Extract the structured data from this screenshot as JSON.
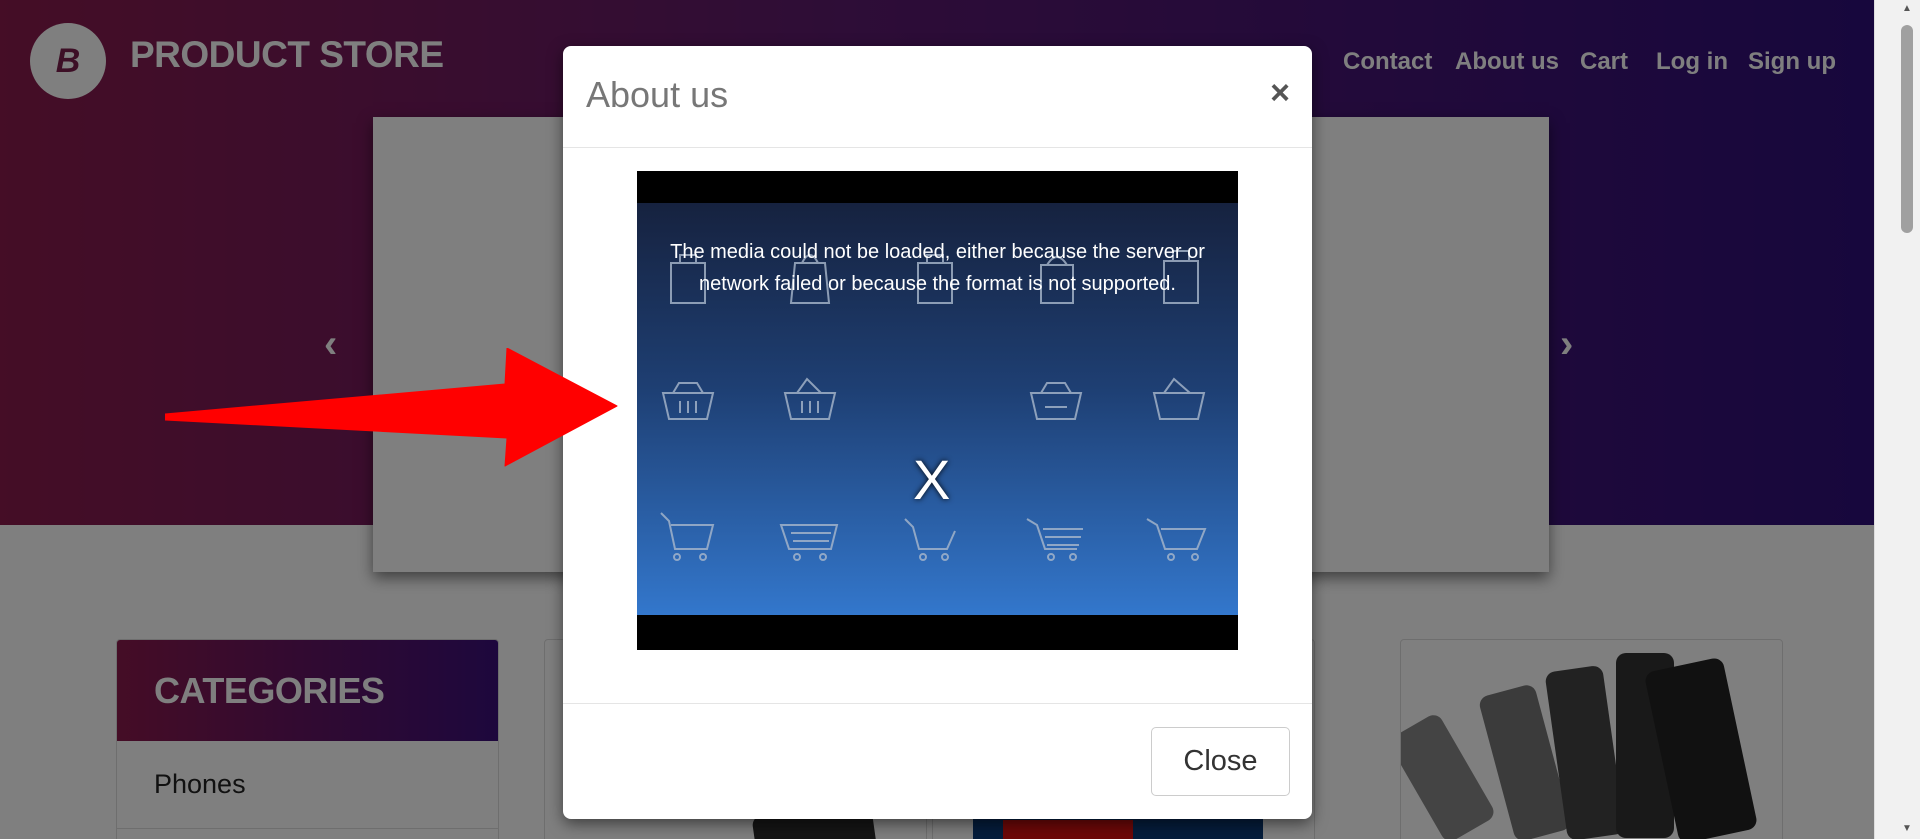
{
  "header": {
    "brand": "PRODUCT STORE",
    "logo_letter": "B",
    "nav": [
      "Contact",
      "About us",
      "Cart",
      "Log in",
      "Sign up"
    ],
    "nav_partial": "e"
  },
  "carousel": {
    "prev_icon": "chevron-left-icon",
    "next_icon": "chevron-right-icon"
  },
  "categories": {
    "title": "CATEGORIES",
    "items": [
      "Phones"
    ]
  },
  "modal": {
    "title": "About us",
    "close_x": "×",
    "video_error": "The media could not be loaded, either because the server or network failed or because the format is not supported.",
    "video_error_icon": "X",
    "close_label": "Close"
  },
  "colors": {
    "hero_start": "#8a1a4c",
    "hero_end": "#2e0f7a",
    "arrow": "#ff0000",
    "video_bg": "#1e3f73"
  }
}
